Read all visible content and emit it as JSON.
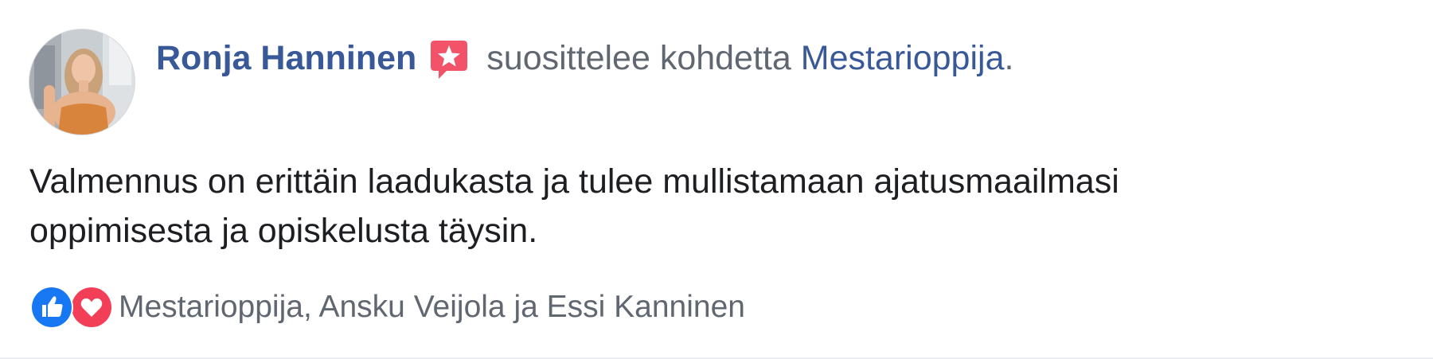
{
  "post": {
    "author_name": "Ronja Hanninen",
    "action_text": "suosittelee kohdetta",
    "page_name": "Mestarioppija",
    "period": ".",
    "review_text": "Valmennus on erittäin laadukasta ja tulee mullistamaan ajatusmaailmasi\noppimisesta ja opiskelusta täysin.",
    "reactions": {
      "icons": [
        "like-icon",
        "love-icon"
      ],
      "reactors_text": "Mestarioppija, Ansku Veijola ja Essi Kanninen"
    }
  },
  "colors": {
    "link": "#385898",
    "secondary_text": "#606770",
    "primary_text": "#1c1e21",
    "like_blue": "#1877f2",
    "love_red": "#f33e58",
    "recommend_badge": "#f35369"
  }
}
